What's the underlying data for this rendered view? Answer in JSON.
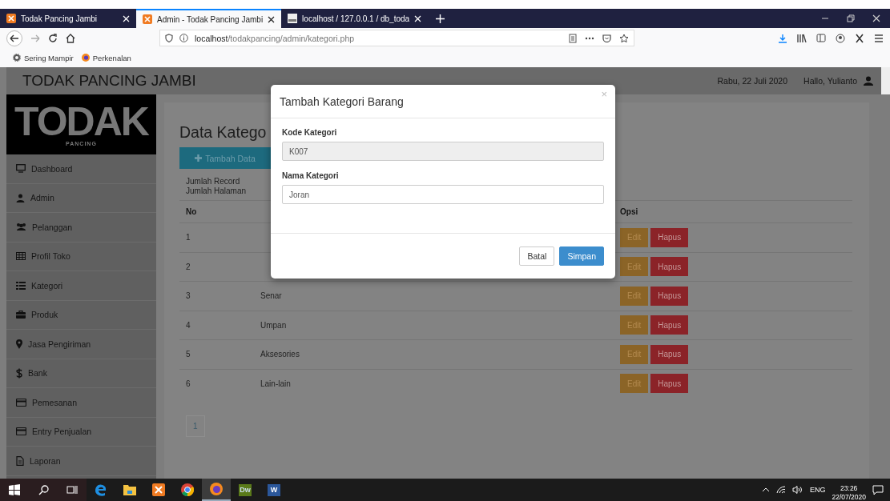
{
  "browser": {
    "tabs": [
      {
        "title": "Todak Pancing Jambi",
        "kind": "xampp",
        "selected": false
      },
      {
        "title": "Admin - Todak Pancing Jambi",
        "kind": "xampp",
        "selected": true
      },
      {
        "title": "localhost / 127.0.0.1 / db_toda",
        "kind": "pma",
        "selected": false
      }
    ],
    "url": {
      "host": "localhost",
      "path": "/todakpancing/admin/kategori.php"
    },
    "bookmarks": [
      {
        "label": "Sering Mampir",
        "kind": "gear"
      },
      {
        "label": "Perkenalan",
        "kind": "firefox"
      }
    ]
  },
  "header": {
    "title": "TODAK PANCING JAMBI",
    "date": "Rabu, 22 Juli 2020",
    "greeting": "Hallo, Yulianto"
  },
  "logo": {
    "text": "TODAK",
    "subtext": "PANCING"
  },
  "sidebar": {
    "items": [
      {
        "label": "Dashboard",
        "kind": "monitor"
      },
      {
        "label": "Admin",
        "kind": "user"
      },
      {
        "label": "Pelanggan",
        "kind": "users"
      },
      {
        "label": "Profil Toko",
        "kind": "table"
      },
      {
        "label": "Kategori",
        "kind": "list"
      },
      {
        "label": "Produk",
        "kind": "briefcase"
      },
      {
        "label": "Jasa Pengiriman",
        "kind": "pin"
      },
      {
        "label": "Bank",
        "kind": "dollar"
      },
      {
        "label": "Pemesanan",
        "kind": "card"
      },
      {
        "label": "Entry Penjualan",
        "kind": "card"
      },
      {
        "label": "Laporan",
        "kind": "file"
      }
    ]
  },
  "content": {
    "title": "Data Katego",
    "add_button": "Tambah Data",
    "stats": [
      "Jumlah Record",
      "Jumlah Halaman"
    ],
    "table": {
      "column_1": "No",
      "column_3": "Opsi",
      "rows": [
        {
          "no": "1",
          "actions": [
            "Edit",
            "Hapus"
          ]
        },
        {
          "no": "2",
          "actions": [
            "Edit",
            "Hapus"
          ]
        },
        {
          "no": "3",
          "name": "Senar",
          "actions": [
            "Edit",
            "Hapus"
          ]
        },
        {
          "no": "4",
          "name": "Umpan",
          "actions": [
            "Edit",
            "Hapus"
          ]
        },
        {
          "no": "5",
          "name": "Aksesories",
          "actions": [
            "Edit",
            "Hapus"
          ]
        },
        {
          "no": "6",
          "name": "Lain-lain",
          "actions": [
            "Edit",
            "Hapus"
          ]
        }
      ]
    },
    "pages": [
      "1"
    ]
  },
  "modal": {
    "title": "Tambah Kategori Barang",
    "close": "×",
    "fields": [
      {
        "label": "Kode Kategori",
        "value": "K007",
        "disabled": true
      },
      {
        "label": "Nama Kategori",
        "value": "Joran",
        "disabled": false
      }
    ],
    "buttons": [
      {
        "label": "Batal",
        "kind": "default"
      },
      {
        "label": "Simpan",
        "kind": "primary"
      }
    ]
  },
  "taskbar": {
    "apps": [
      {
        "kind": "edge",
        "active": false
      },
      {
        "kind": "explorer",
        "active": false
      },
      {
        "kind": "xampp",
        "active": false
      },
      {
        "kind": "chrome",
        "active": false
      },
      {
        "kind": "firefox",
        "active": true
      },
      {
        "kind": "dw",
        "label": "Dw",
        "active": false
      },
      {
        "kind": "word",
        "label": "W",
        "active": false
      }
    ],
    "language": "ENG",
    "time": "23:26",
    "date": "22/07/2020"
  }
}
